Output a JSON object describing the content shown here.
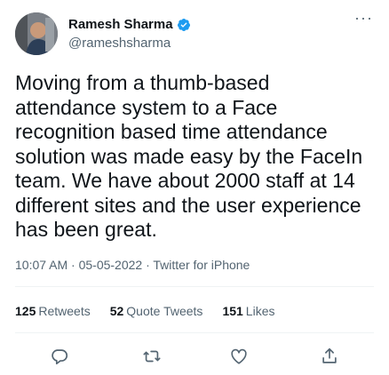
{
  "user": {
    "name": "Ramesh Sharma",
    "handle": "@rameshsharma"
  },
  "tweet": {
    "text": "Moving from a thumb-based attendance system to a Face recognition based time attendance solution was made easy by the FaceIn team. We have about 2000 staff at 14 different sites and the user experience has been great.",
    "meta": "10:07 AM · 05-05-2022 · Twitter for iPhone"
  },
  "stats": {
    "retweets_count": "125",
    "retweets_label": "Retweets",
    "quotes_count": "52",
    "quotes_label": "Quote Tweets",
    "likes_count": "151",
    "likes_label": "Likes"
  },
  "colors": {
    "verified": "#1d9bf0",
    "secondary_text": "#536471"
  },
  "icons": [
    "more-icon",
    "verified-icon",
    "reply-icon",
    "retweet-icon",
    "like-icon",
    "share-icon"
  ]
}
